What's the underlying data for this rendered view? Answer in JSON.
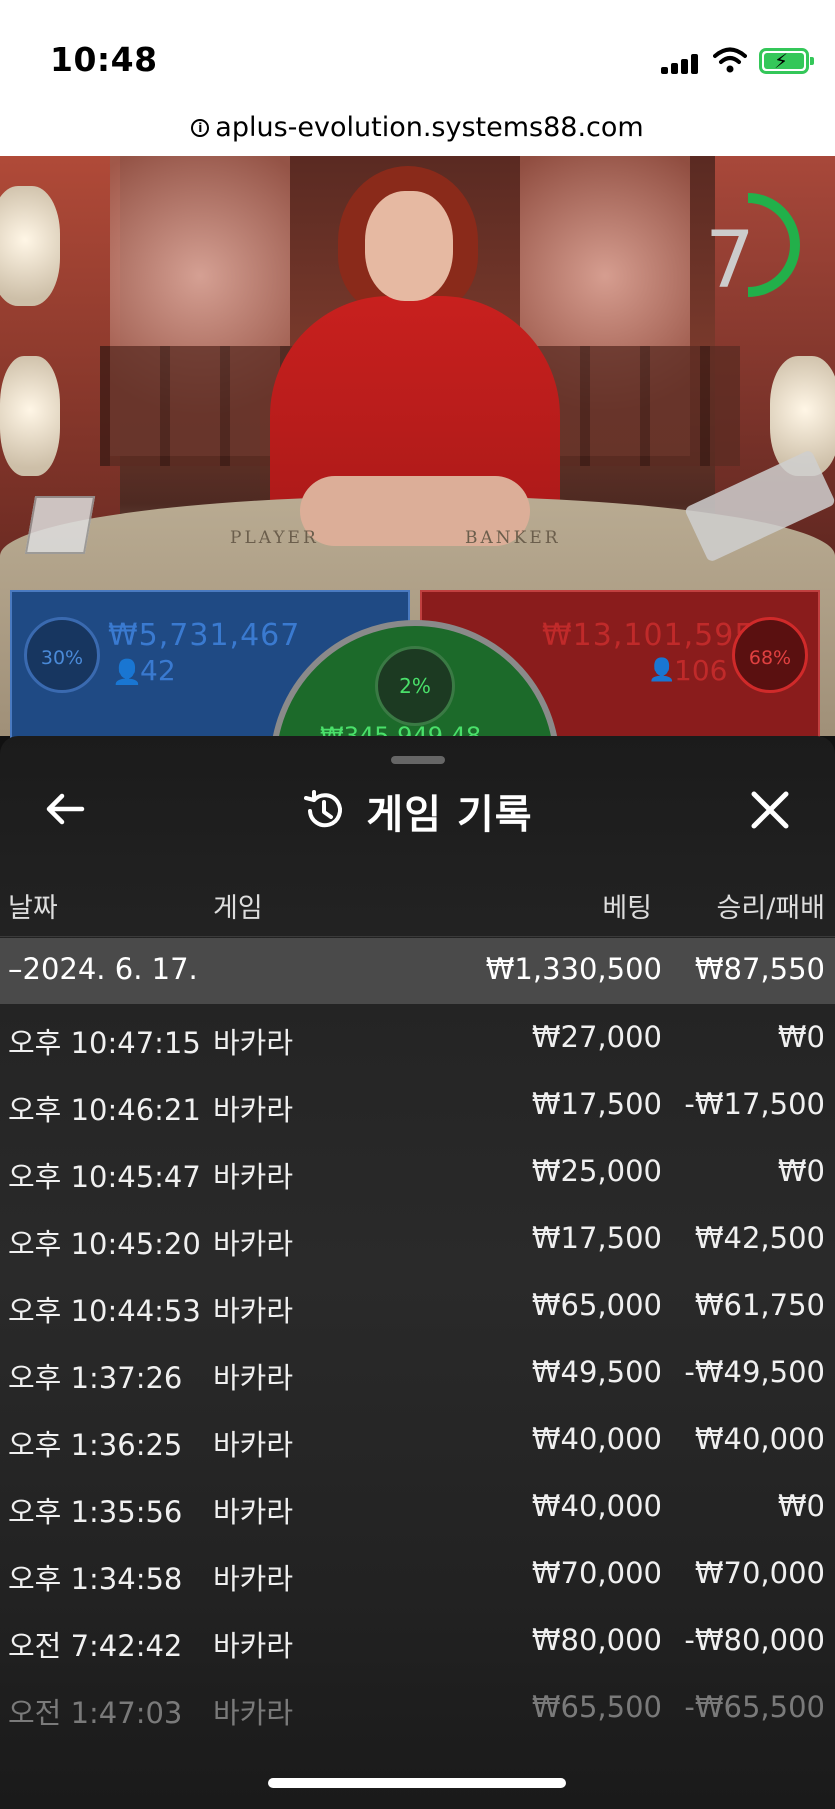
{
  "status_bar": {
    "time": "10:48"
  },
  "browser": {
    "url": "aplus-evolution.systems88.com"
  },
  "game_view": {
    "countdown": "7",
    "table_labels": {
      "player": "PLAYER",
      "banker": "BANKER"
    },
    "player_bet": {
      "percent": "30%",
      "amount": "₩5,731,467",
      "players": "42"
    },
    "banker_bet": {
      "percent": "68%",
      "amount": "₩13,101,595",
      "players": "106"
    },
    "tie_bet": {
      "percent": "2%",
      "amount": "₩345,949.48"
    }
  },
  "history": {
    "title": "게임 기록",
    "columns": {
      "date": "날짜",
      "game": "게임",
      "bet": "베팅",
      "win_loss": "승리/패배"
    },
    "date_group": {
      "date": "–2024. 6. 17.",
      "bet_total": "₩1,330,500",
      "win_total": "₩87,550"
    },
    "rows": [
      {
        "time": "오후 10:47:15",
        "game": "바카라",
        "bet": "₩27,000",
        "result": "₩0"
      },
      {
        "time": "오후 10:46:21",
        "game": "바카라",
        "bet": "₩17,500",
        "result": "-₩17,500"
      },
      {
        "time": "오후 10:45:47",
        "game": "바카라",
        "bet": "₩25,000",
        "result": "₩0"
      },
      {
        "time": "오후 10:45:20",
        "game": "바카라",
        "bet": "₩17,500",
        "result": "₩42,500"
      },
      {
        "time": "오후 10:44:53",
        "game": "바카라",
        "bet": "₩65,000",
        "result": "₩61,750"
      },
      {
        "time": "오후 1:37:26",
        "game": "바카라",
        "bet": "₩49,500",
        "result": "-₩49,500"
      },
      {
        "time": "오후 1:36:25",
        "game": "바카라",
        "bet": "₩40,000",
        "result": "₩40,000"
      },
      {
        "time": "오후 1:35:56",
        "game": "바카라",
        "bet": "₩40,000",
        "result": "₩0"
      },
      {
        "time": "오후 1:34:58",
        "game": "바카라",
        "bet": "₩70,000",
        "result": "₩70,000"
      },
      {
        "time": "오전 7:42:42",
        "game": "바카라",
        "bet": "₩80,000",
        "result": "-₩80,000"
      },
      {
        "time": "오전 1:47:03",
        "game": "바카라",
        "bet": "₩65,500",
        "result": "-₩65,500"
      }
    ]
  },
  "colors": {
    "player": "#1f4a84",
    "banker": "#8a1c1c",
    "tie": "#1c6a2a",
    "timer": "#22b04a"
  }
}
